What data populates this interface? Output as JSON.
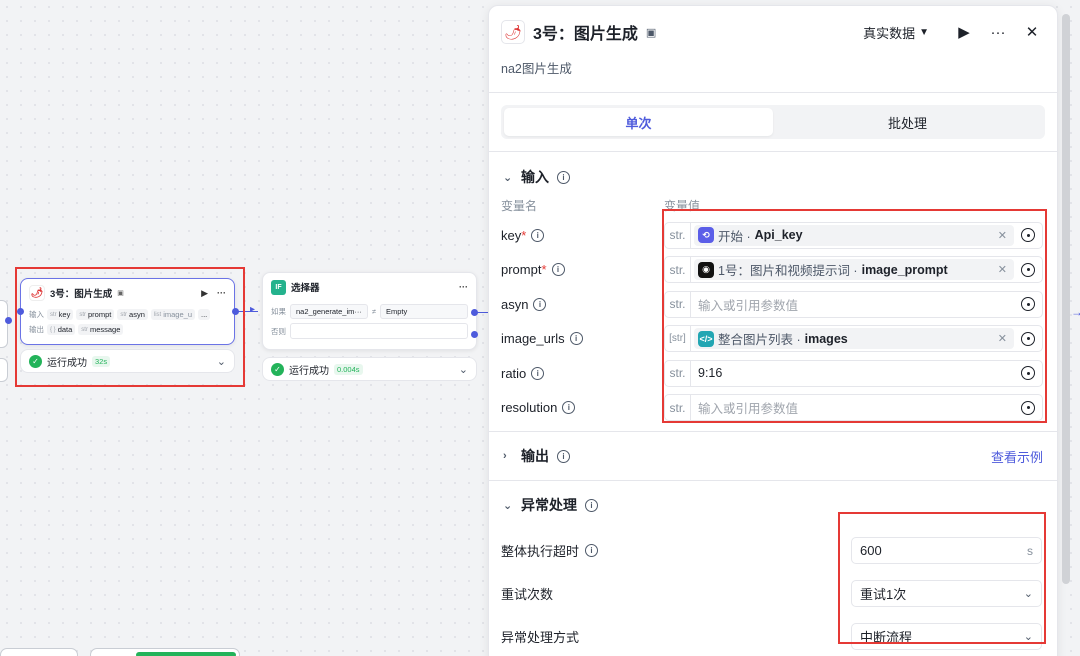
{
  "canvas": {
    "node1": {
      "title": "3号：图片生成",
      "input_label": "输入",
      "output_label": "输出",
      "inputs": [
        {
          "type": "str",
          "name": "key"
        },
        {
          "type": "str",
          "name": "prompt"
        },
        {
          "type": "str",
          "name": "asyn"
        },
        {
          "type": "list",
          "name": "image_u"
        }
      ],
      "more": "...",
      "outputs": [
        {
          "type": "{ }",
          "name": "data"
        },
        {
          "type": "str",
          "name": "message"
        }
      ],
      "status": "运行成功",
      "time": "32s"
    },
    "node2": {
      "title": "选择器",
      "icon_label": "IF",
      "if_label": "如果",
      "else_label": "否则",
      "cond_field": "na2_generate_im···",
      "operator": "≠",
      "cond_value": "Empty",
      "status": "运行成功",
      "time": "0.004s"
    }
  },
  "panel": {
    "title": "3号：图片生成",
    "subtitle": "na2图片生成",
    "data_mode": "真实数据",
    "tabs": [
      {
        "label": "单次",
        "active": true
      },
      {
        "label": "批处理",
        "active": false
      }
    ],
    "input_section": {
      "title": "输入",
      "col_name": "变量名",
      "col_value": "变量值",
      "rows": [
        {
          "name": "key",
          "required": true,
          "type": "str.",
          "kind": "ref",
          "ref_source": "开始 · ",
          "ref_var": "Api_key",
          "icon": "start-icon",
          "icon_color": "#5b5ee8"
        },
        {
          "name": "prompt",
          "required": true,
          "type": "str.",
          "kind": "ref",
          "ref_source": "1号：图片和视频提示词 · ",
          "ref_var": "image_prompt",
          "icon": "ghost-icon",
          "icon_color": "#111111"
        },
        {
          "name": "asyn",
          "required": false,
          "type": "str.",
          "kind": "placeholder",
          "placeholder": "输入或引用参数值"
        },
        {
          "name": "image_urls",
          "required": false,
          "type": "[str]",
          "kind": "ref",
          "ref_source": "整合图片列表 · ",
          "ref_var": "images",
          "icon": "code-icon",
          "icon_color": "#22a6b3"
        },
        {
          "name": "ratio",
          "required": false,
          "type": "str.",
          "kind": "text",
          "value": "9:16"
        },
        {
          "name": "resolution",
          "required": false,
          "type": "str.",
          "kind": "placeholder",
          "placeholder": "输入或引用参数值"
        }
      ]
    },
    "output_section": {
      "title": "输出",
      "link": "查看示例"
    },
    "error_section": {
      "title": "异常处理",
      "timeout_label": "整体执行超时",
      "timeout_value": "600",
      "timeout_unit": "s",
      "retry_label": "重试次数",
      "retry_value": "重试1次",
      "mode_label": "异常处理方式",
      "mode_value": "中断流程"
    }
  },
  "colors": {
    "accent": "#4e5bdc",
    "highlight_border": "#e53935",
    "success": "#23b35a"
  }
}
